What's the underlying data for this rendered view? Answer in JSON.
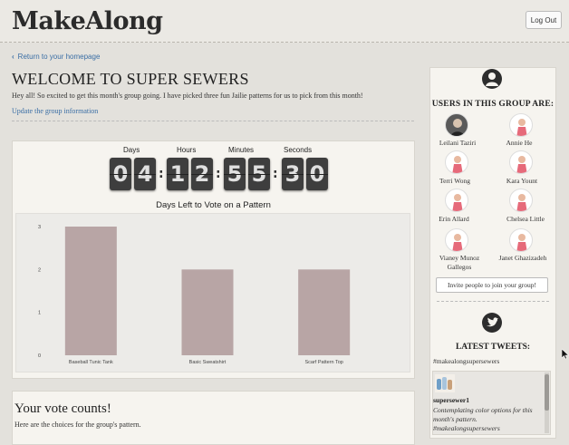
{
  "app": {
    "logo": "MakeAlong",
    "logout_label": "Log Out"
  },
  "nav": {
    "back_label": "Return to your homepage"
  },
  "group": {
    "title": "WELCOME TO SUPER SEWERS",
    "description": "Hey all! So excited to get this month's group going. I have picked three fun Jailie patterns for us to pick from this month!",
    "update_link": "Update the group information"
  },
  "countdown": {
    "labels": {
      "days": "Days",
      "hours": "Hours",
      "minutes": "Minutes",
      "seconds": "Seconds"
    },
    "digits": [
      "0",
      "4",
      "1",
      "2",
      "5",
      "5",
      "3",
      "0"
    ]
  },
  "chart_data": {
    "type": "bar",
    "title": "Days Left to Vote on a Pattern",
    "categories": [
      "Baseball Tunic Tank",
      "Basic Sweatshirt",
      "Scarf Pattern Top"
    ],
    "values": [
      3,
      2,
      2
    ],
    "ylim": [
      0,
      3
    ],
    "yticks": [
      "0",
      "1",
      "2",
      "3"
    ],
    "bar_color": "#b8a5a5",
    "grid": false
  },
  "vote": {
    "title": "Your vote counts!",
    "text": "Here are the choices for the group's pattern."
  },
  "sidebar": {
    "users_title": "USERS IN THIS GROUP ARE:",
    "users": [
      {
        "name": "Leilani Taziri"
      },
      {
        "name": "Annie He"
      },
      {
        "name": "Terri Wong"
      },
      {
        "name": "Kara Yount"
      },
      {
        "name": "Erin Allard"
      },
      {
        "name": "Chelsea Little"
      },
      {
        "name": "Vianey Munoz Gallegos"
      },
      {
        "name": "Janet Ghazizadeh"
      }
    ],
    "invite_label": "Invite people to join your group!",
    "tweets_title": "LATEST TWEETS:",
    "hashtag": "#makealongsupersewers",
    "tweet": {
      "user": "supersewer1",
      "text": "Contemplating color options for this month's pattern. #makealongsupersewers"
    }
  },
  "colors": {
    "link": "#3a6ea5",
    "bar": "#b8a5a5",
    "panel": "#f6f4ef",
    "page": "#e3e1dc"
  }
}
